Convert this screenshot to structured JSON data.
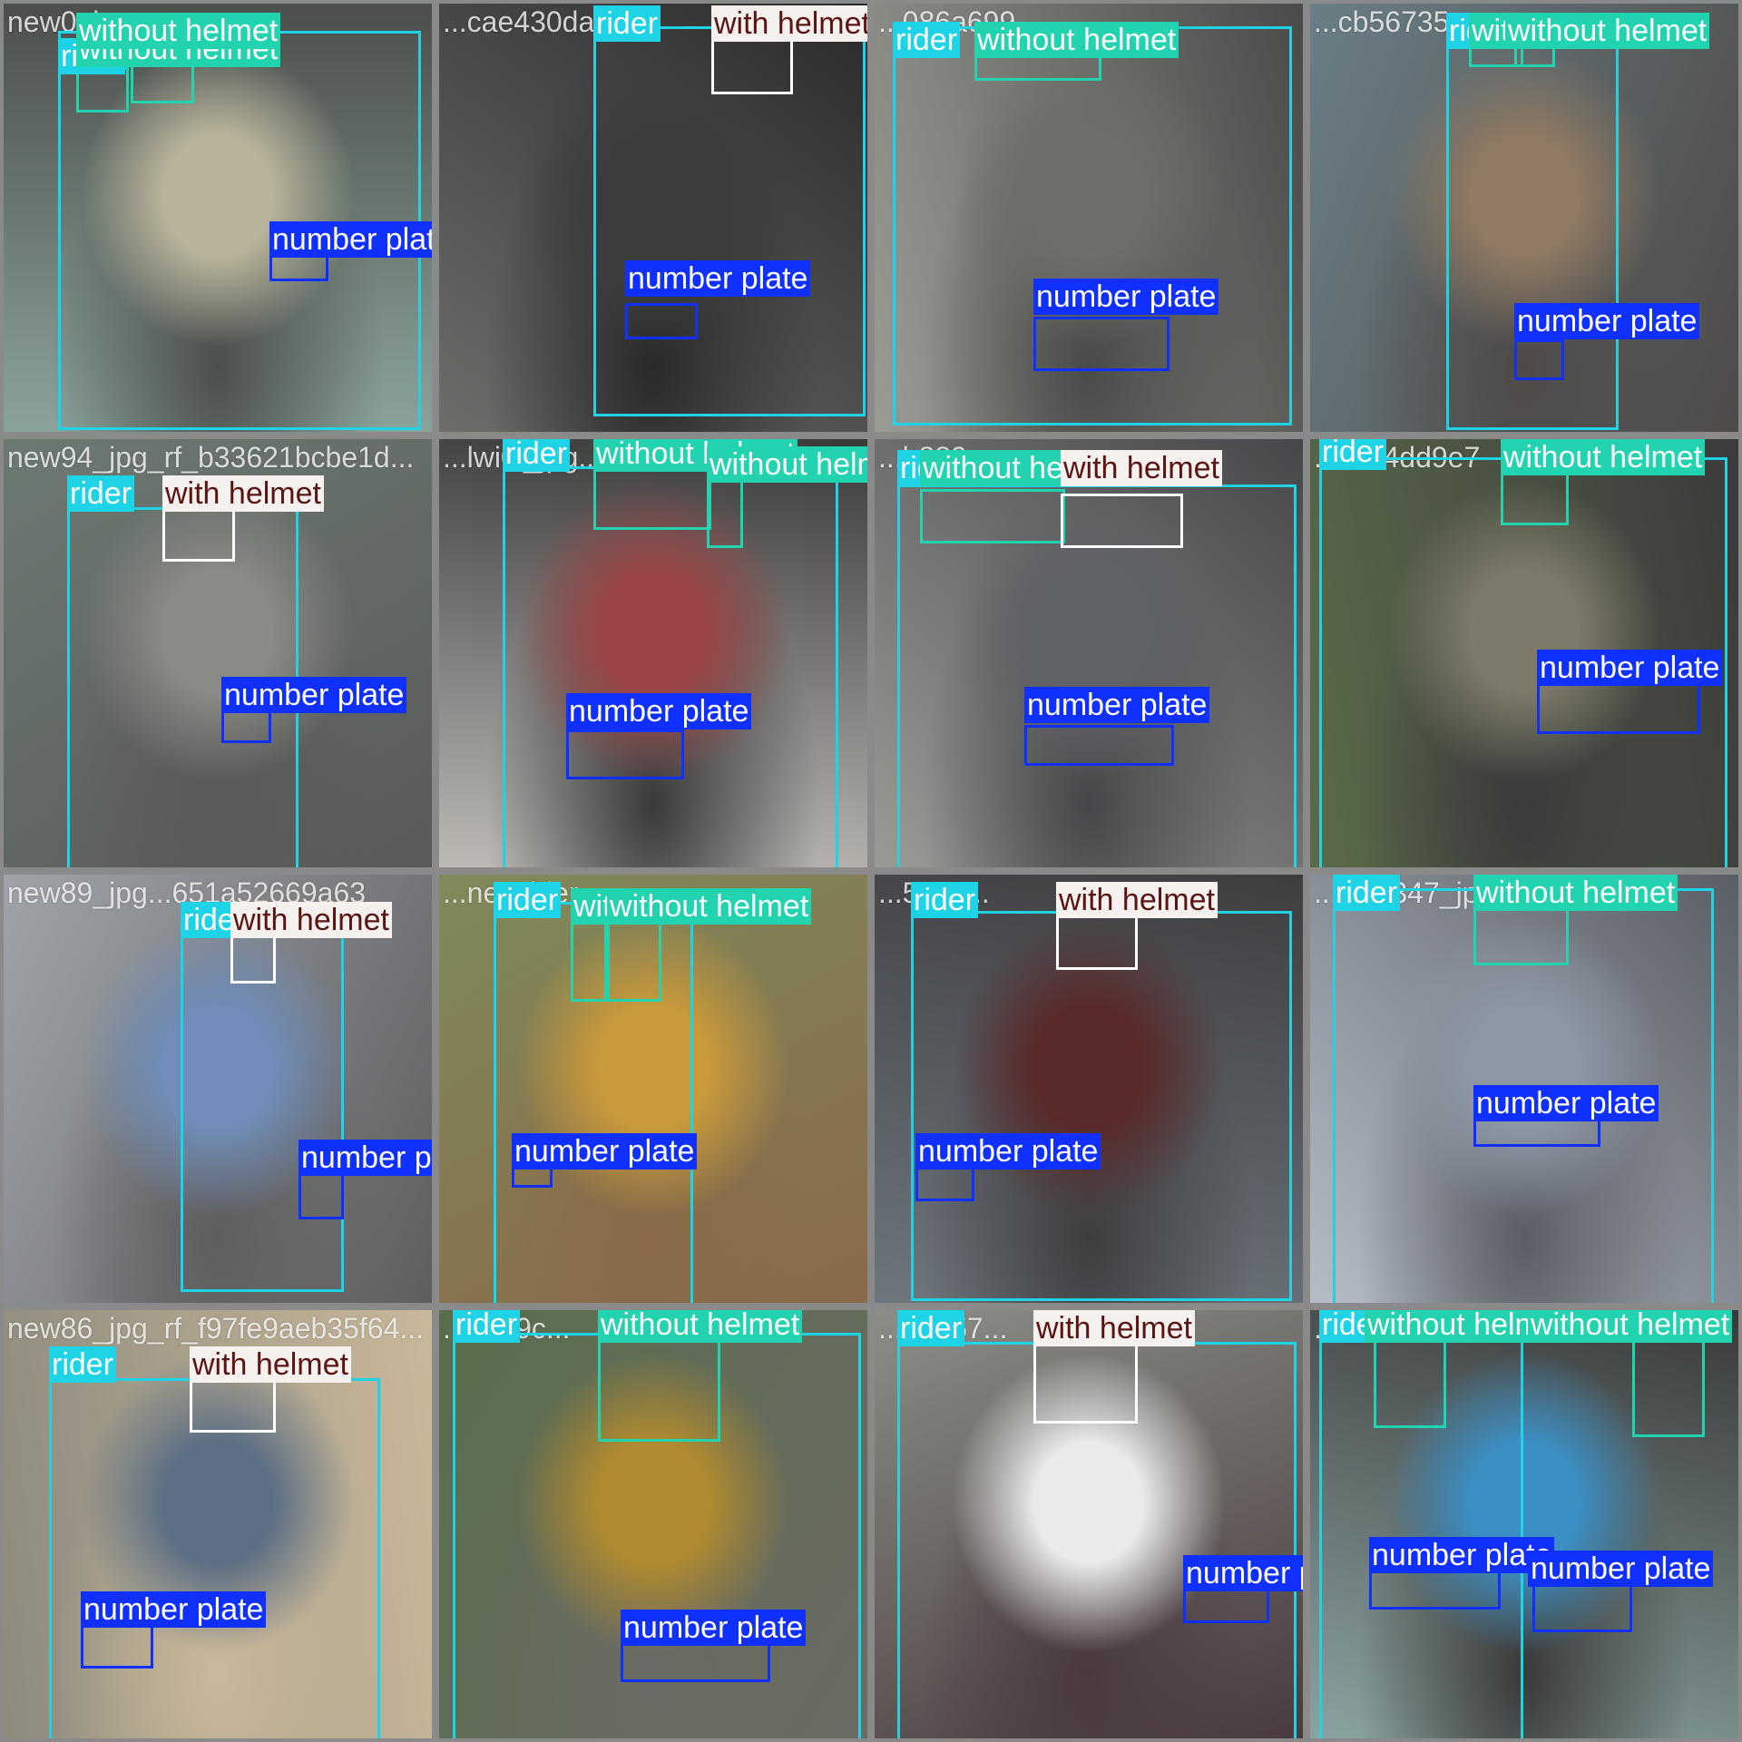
{
  "page": {
    "grid_cols": 4,
    "grid_rows": 4
  },
  "class_colors": {
    "rider": "#1fd3e6",
    "without_helmet": "#22d3b0",
    "with_helmet": "#ffffff",
    "number_plate": "#1030ff"
  },
  "label_text": {
    "rider": "rider",
    "without_helmet": "without helmet",
    "with_helmet": "with helmet",
    "number_plate": "number plate"
  },
  "tiles": [
    {
      "file": "new0_jpg...",
      "bg": [
        "#8aa39a",
        "#b9b39a",
        "#4c4f4c"
      ],
      "boxes": [
        {
          "cls": "rider"
        },
        {
          "cls": "without_helmet"
        },
        {
          "cls": "without_helmet"
        },
        {
          "cls": "number_plate"
        }
      ]
    },
    {
      "file": "...cae430da...",
      "bg": [
        "#6d6d6a",
        "#3d3d3d",
        "#2a2a2a"
      ],
      "boxes": [
        {
          "cls": "rider"
        },
        {
          "cls": "with_helmet"
        },
        {
          "cls": "number_plate"
        }
      ]
    },
    {
      "file": "...086a699...",
      "bg": [
        "#9b9b96",
        "#6e6e6a",
        "#4a4a48"
      ],
      "boxes": [
        {
          "cls": "rider"
        },
        {
          "cls": "without_helmet"
        },
        {
          "cls": "number_plate"
        }
      ]
    },
    {
      "file": "...cb56735...",
      "bg": [
        "#6a7e86",
        "#8f7a63",
        "#4e4a48"
      ],
      "boxes": [
        {
          "cls": "rider"
        },
        {
          "cls": "without_helmet"
        },
        {
          "cls": "without_helmet"
        },
        {
          "cls": "number_plate"
        }
      ]
    },
    {
      "file": "new94_jpg_rf_b33621bcbe1d...",
      "bg": [
        "#6c7a72",
        "#8a8a86",
        "#5a5a58"
      ],
      "boxes": [
        {
          "cls": "rider"
        },
        {
          "cls": "with_helmet"
        },
        {
          "cls": "number_plate"
        }
      ]
    },
    {
      "file": "...lwi0l_jpg...",
      "bg": [
        "#bdbab6",
        "#9a4646",
        "#3a3a3a"
      ],
      "boxes": [
        {
          "cls": "rider"
        },
        {
          "cls": "without_helmet"
        },
        {
          "cls": "without_helmet"
        },
        {
          "cls": "number_plate"
        }
      ]
    },
    {
      "file": "...b889...",
      "bg": [
        "#9a9a96",
        "#5f6266",
        "#45474a"
      ],
      "boxes": [
        {
          "cls": "rider"
        },
        {
          "cls": "without_helmet"
        },
        {
          "cls": "with_helmet"
        },
        {
          "cls": "number_plate"
        }
      ]
    },
    {
      "file": "...ecc4dd9e7",
      "bg": [
        "#5a6b4a",
        "#7e7a6a",
        "#3b3b3b"
      ],
      "boxes": [
        {
          "cls": "rider"
        },
        {
          "cls": "without_helmet"
        },
        {
          "cls": "number_plate"
        }
      ]
    },
    {
      "file": "new89_jpg...651a52669a63",
      "bg": [
        "#9fa3a8",
        "#6f8db8",
        "#5e5e60"
      ],
      "boxes": [
        {
          "cls": "rider"
        },
        {
          "cls": "with_helmet"
        },
        {
          "cls": "number_plate"
        }
      ]
    },
    {
      "file": "...newrider...",
      "bg": [
        "#7f8a5a",
        "#c99a3a",
        "#8a6a4a"
      ],
      "boxes": [
        {
          "cls": "rider"
        },
        {
          "cls": "without_helmet"
        },
        {
          "cls": "without_helmet"
        },
        {
          "cls": "number_plate"
        }
      ]
    },
    {
      "file": "...5c15...",
      "bg": [
        "#6e767e",
        "#5a2a2a",
        "#3e3e40"
      ],
      "boxes": [
        {
          "cls": "rider"
        },
        {
          "cls": "with_helmet"
        },
        {
          "cls": "number_plate"
        }
      ]
    },
    {
      "file": "...new347_jpg...",
      "bg": [
        "#b5bcc6",
        "#8d96a5",
        "#5a5f66"
      ],
      "boxes": [
        {
          "cls": "rider"
        },
        {
          "cls": "without_helmet"
        },
        {
          "cls": "number_plate"
        }
      ]
    },
    {
      "file": "new86_jpg_rf_f97fe9aeb35f64...",
      "bg": [
        "#8d8a7e",
        "#5c6f84",
        "#c9b89a"
      ],
      "boxes": [
        {
          "cls": "rider"
        },
        {
          "cls": "with_helmet"
        },
        {
          "cls": "number_plate"
        }
      ]
    },
    {
      "file": "...1b69c...",
      "bg": [
        "#5a6e4e",
        "#b08a2e",
        "#6b6b64"
      ],
      "boxes": [
        {
          "cls": "rider"
        },
        {
          "cls": "without_helmet"
        },
        {
          "cls": "number_plate"
        }
      ]
    },
    {
      "file": "...e2057...",
      "bg": [
        "#8a8e86",
        "#eaeaea",
        "#4a3a3e"
      ],
      "boxes": [
        {
          "cls": "rider"
        },
        {
          "cls": "with_helmet"
        },
        {
          "cls": "number_plate"
        }
      ]
    },
    {
      "file": "...2cb7d...",
      "bg": [
        "#8aa3a0",
        "#3c8fc4",
        "#3a3a3a"
      ],
      "boxes": [
        {
          "cls": "rider"
        },
        {
          "cls": "without_helmet"
        },
        {
          "cls": "without_helmet"
        },
        {
          "cls": "number_plate"
        },
        {
          "cls": "number_plate"
        }
      ]
    }
  ]
}
